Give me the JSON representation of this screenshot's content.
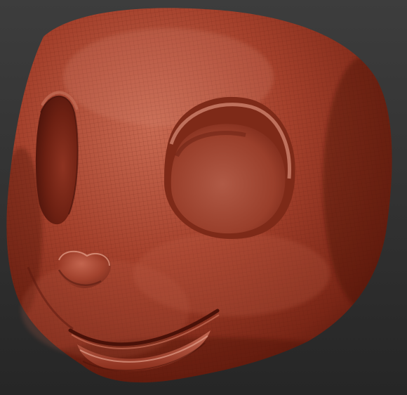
{
  "viewport": {
    "background_top": "#3d3d3d",
    "background_bottom": "#262626"
  },
  "model": {
    "subject": "stylized-cartoon-head-sculpt",
    "material_base": "#a5412c",
    "material_highlight": "#d88a74",
    "material_shadow": "#4e140b",
    "wireframe_visible": true,
    "features": [
      "head",
      "eye-socket-left",
      "eye-socket-right",
      "nose",
      "mouth-smile",
      "lower-lip"
    ]
  }
}
